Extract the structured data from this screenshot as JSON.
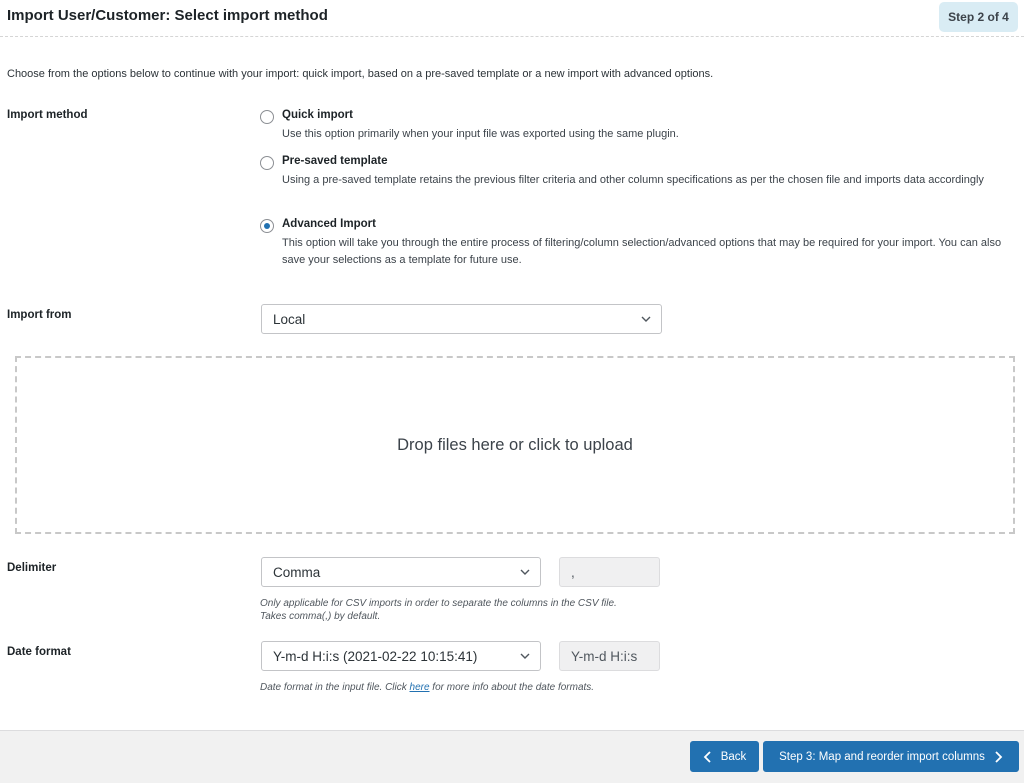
{
  "header": {
    "title": "Import User/Customer: Select import method",
    "step_badge": "Step 2 of 4"
  },
  "intro": "Choose from the options below to continue with your import: quick import, based on a pre-saved template or a new import with advanced options.",
  "import_method": {
    "label": "Import method",
    "selected": "advanced",
    "options": [
      {
        "id": "quick",
        "title": "Quick import",
        "description": "Use this option primarily when your input file was exported using the same plugin.",
        "checked": false
      },
      {
        "id": "template",
        "title": "Pre-saved template",
        "description": "Using a pre-saved template retains the previous filter criteria and other column specifications as per the chosen file and imports data accordingly",
        "checked": false
      },
      {
        "id": "advanced",
        "title": "Advanced Import",
        "description": "This option will take you through the entire process of filtering/column selection/advanced options that may be required for your import. You can also save your selections as a template for future use.",
        "checked": true
      }
    ]
  },
  "import_from": {
    "label": "Import from",
    "value": "Local"
  },
  "dropzone": {
    "text": "Drop files here or click to upload"
  },
  "delimiter": {
    "label": "Delimiter",
    "value": "Comma",
    "char": ",",
    "help_line1": "Only applicable for CSV imports in order to separate the columns in the CSV file.",
    "help_line2": "Takes comma(,) by default."
  },
  "date_format": {
    "label": "Date format",
    "value": "Y-m-d H:i:s (2021-02-22 10:15:41)",
    "format": "Y-m-d H:i:s",
    "help_before": "Date format in the input file. Click ",
    "help_link": "here",
    "help_after": " for more info about the date formats."
  },
  "footer": {
    "back_label": "Back",
    "next_label": "Step 3: Map and reorder import columns"
  },
  "colors": {
    "accent": "#2271b1",
    "badge_bg": "#d9ecf4"
  }
}
